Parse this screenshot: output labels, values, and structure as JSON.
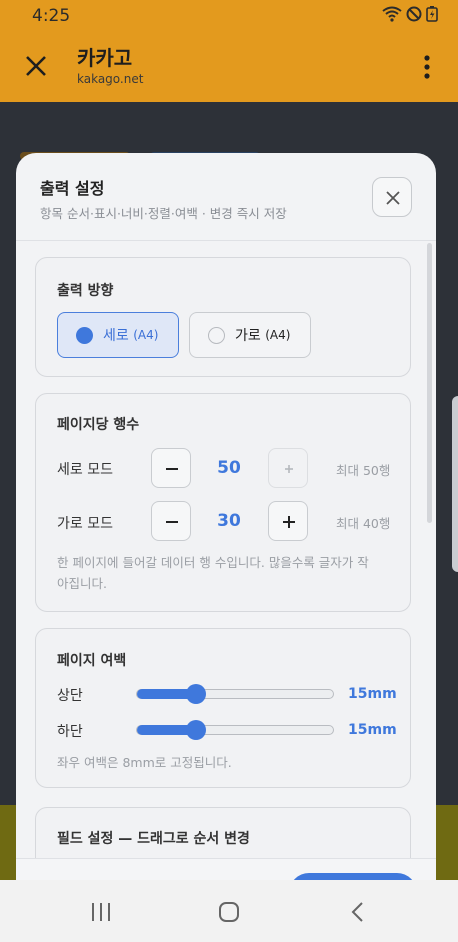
{
  "status": {
    "time": "4:25"
  },
  "browser": {
    "title": "카카고",
    "url": "kakago.net"
  },
  "sheet": {
    "title": "출력 설정",
    "subtitle": "항목 순서·표시·너비·정렬·여백 · 변경 즉시 저장"
  },
  "orientation": {
    "title": "출력 방향",
    "options": [
      {
        "label": "세로",
        "paper": "(A4)",
        "selected": true
      },
      {
        "label": "가로",
        "paper": "(A4)",
        "selected": false
      }
    ]
  },
  "rows_per_page": {
    "title": "페이지당 행수",
    "portrait": {
      "label": "세로 모드",
      "value": "50",
      "max": "최대 50행",
      "plus_disabled": true
    },
    "landscape": {
      "label": "가로 모드",
      "value": "30",
      "max": "최대 40행",
      "plus_disabled": false
    },
    "hint": "한 페이지에 들어갈 데이터 행 수입니다. 많을수록 글자가 작아집니다."
  },
  "margins": {
    "title": "페이지 여백",
    "top": {
      "label": "상단",
      "value": "15mm",
      "level": 0.3
    },
    "bottom": {
      "label": "하단",
      "value": "15mm",
      "level": 0.3
    },
    "hint": "좌우 여백은 8mm로 고정됩니다."
  },
  "fields": {
    "title": "필드 설정 — 드래그로 순서 변경"
  },
  "colors": {
    "accent": "#3f78dc",
    "header": "#e39a1e"
  }
}
